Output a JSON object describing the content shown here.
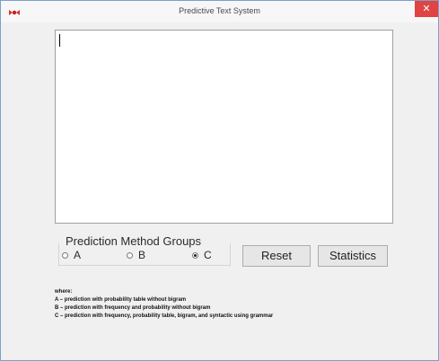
{
  "window": {
    "title": "Predictive Text System",
    "close_glyph": "✕"
  },
  "editor": {
    "value": ""
  },
  "prediction_group": {
    "label": "Prediction Method Groups",
    "options": [
      {
        "label": "A",
        "checked": false
      },
      {
        "label": "B",
        "checked": false
      },
      {
        "label": "C",
        "checked": true
      }
    ]
  },
  "buttons": {
    "reset": "Reset",
    "statistics": "Statistics"
  },
  "legend": {
    "heading": "where:",
    "lines": [
      "A – prediction with probability table without bigram",
      "B – prediction with frequency and probability without bigram",
      "C – prediction with frequency, probability table, bigram, and syntactic using grammar"
    ]
  },
  "colors": {
    "close_button": "#e04343",
    "window_border": "#7aa0cc",
    "client_background": "#f0f0f0"
  },
  "icons": {
    "app": "red-bird-icon",
    "close": "close-icon"
  }
}
